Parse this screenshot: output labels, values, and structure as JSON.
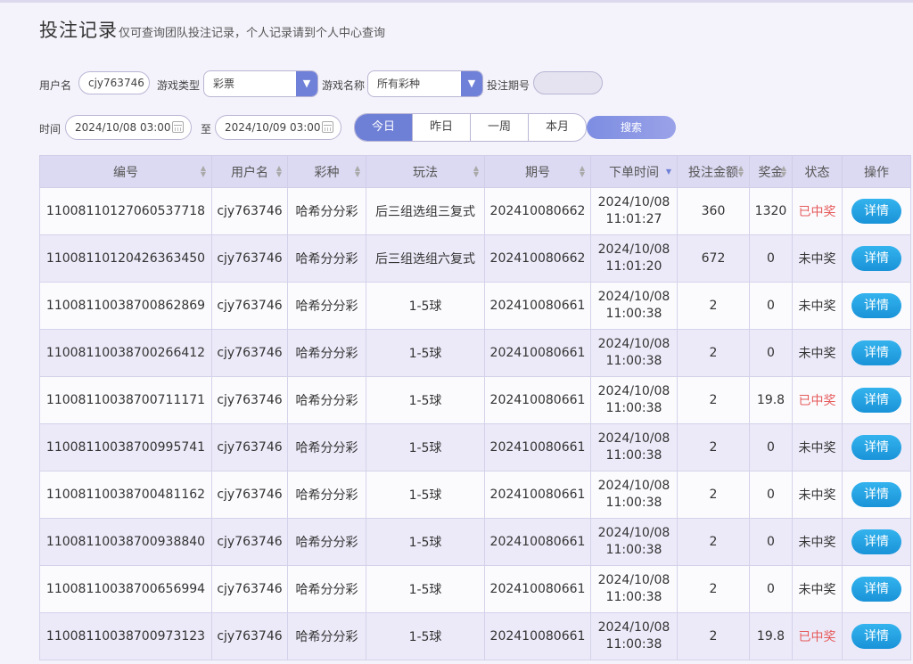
{
  "header": {
    "title": "投注记录",
    "subtitle": "仅可查询团队投注记录，个人记录请到个人中心查询"
  },
  "filters": {
    "username_label": "用户名",
    "username_value": "cjy763746",
    "game_type_label": "游戏类型",
    "game_type_value": "彩票",
    "game_name_label": "游戏名称",
    "game_name_value": "所有彩种",
    "period_label": "投注期号",
    "period_value": "",
    "time_label": "时间",
    "start_time": "2024/10/08 03:00",
    "to_label": "至",
    "end_time": "2024/10/09 03:00",
    "ranges": [
      "今日",
      "昨日",
      "一周",
      "本月"
    ],
    "active_range": "今日",
    "search_label": "搜索"
  },
  "table": {
    "columns": [
      "编号",
      "用户名",
      "彩种",
      "玩法",
      "期号",
      "下单时间",
      "投注金额",
      "奖金",
      "状态",
      "操作"
    ],
    "rows": [
      {
        "id": "1100811012706053771​8",
        "user": "cjy763746",
        "lottery": "哈希分分彩",
        "play": "后三组选组三复式",
        "period": "202410080662",
        "date": "2024/10/08",
        "time": "11:01:27",
        "amount": "360",
        "prize": "1320",
        "status": "已中奖",
        "action": "详情"
      },
      {
        "id": "11008110120426363450",
        "user": "cjy763746",
        "lottery": "哈希分分彩",
        "play": "后三组选组六复式",
        "period": "202410080662",
        "date": "2024/10/08",
        "time": "11:01:20",
        "amount": "672",
        "prize": "0",
        "status": "未中奖",
        "action": "详情"
      },
      {
        "id": "11008110038700862869",
        "user": "cjy763746",
        "lottery": "哈希分分彩",
        "play": "1-5球",
        "period": "202410080661",
        "date": "2024/10/08",
        "time": "11:00:38",
        "amount": "2",
        "prize": "0",
        "status": "未中奖",
        "action": "详情"
      },
      {
        "id": "11008110038700266412",
        "user": "cjy763746",
        "lottery": "哈希分分彩",
        "play": "1-5球",
        "period": "202410080661",
        "date": "2024/10/08",
        "time": "11:00:38",
        "amount": "2",
        "prize": "0",
        "status": "未中奖",
        "action": "详情"
      },
      {
        "id": "11008110038700711171",
        "user": "cjy763746",
        "lottery": "哈希分分彩",
        "play": "1-5球",
        "period": "202410080661",
        "date": "2024/10/08",
        "time": "11:00:38",
        "amount": "2",
        "prize": "19.8",
        "status": "已中奖",
        "action": "详情"
      },
      {
        "id": "11008110038700995741",
        "user": "cjy763746",
        "lottery": "哈希分分彩",
        "play": "1-5球",
        "period": "202410080661",
        "date": "2024/10/08",
        "time": "11:00:38",
        "amount": "2",
        "prize": "0",
        "status": "未中奖",
        "action": "详情"
      },
      {
        "id": "11008110038700481162",
        "user": "cjy763746",
        "lottery": "哈希分分彩",
        "play": "1-5球",
        "period": "202410080661",
        "date": "2024/10/08",
        "time": "11:00:38",
        "amount": "2",
        "prize": "0",
        "status": "未中奖",
        "action": "详情"
      },
      {
        "id": "11008110038700938840",
        "user": "cjy763746",
        "lottery": "哈希分分彩",
        "play": "1-5球",
        "period": "202410080661",
        "date": "2024/10/08",
        "time": "11:00:38",
        "amount": "2",
        "prize": "0",
        "status": "未中奖",
        "action": "详情"
      },
      {
        "id": "11008110038700656994",
        "user": "cjy763746",
        "lottery": "哈希分分彩",
        "play": "1-5球",
        "period": "202410080661",
        "date": "2024/10/08",
        "time": "11:00:38",
        "amount": "2",
        "prize": "0",
        "status": "未中奖",
        "action": "详情"
      },
      {
        "id": "11008110038700973123",
        "user": "cjy763746",
        "lottery": "哈希分分彩",
        "play": "1-5球",
        "period": "202410080661",
        "date": "2024/10/08",
        "time": "11:00:38",
        "amount": "2",
        "prize": "19.8",
        "status": "已中奖",
        "action": "详情"
      }
    ]
  },
  "colors": {
    "accent": "#6e7fd6",
    "win": "#e65a5a",
    "detail_button": "#1a93d8",
    "header_bg": "#dcdaf2"
  }
}
